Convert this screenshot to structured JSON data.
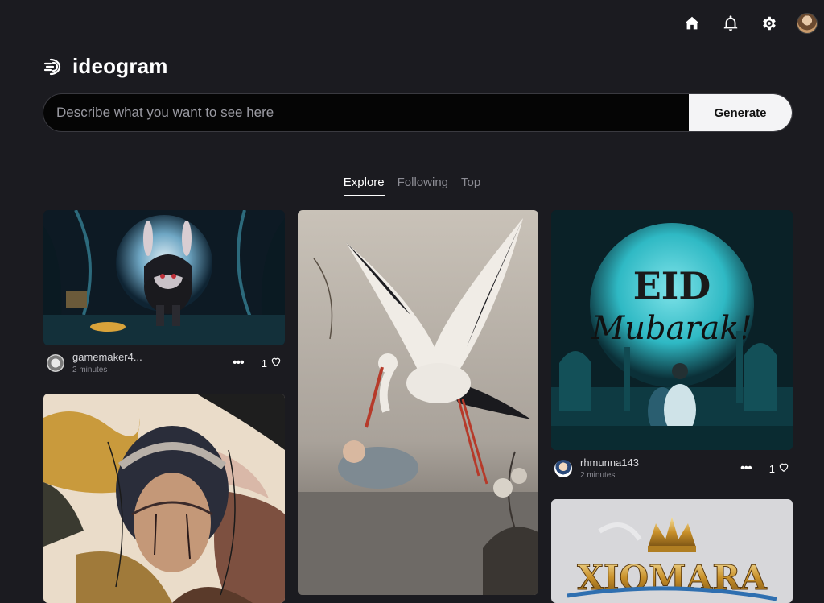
{
  "app": {
    "logo_text": "ideogram"
  },
  "search": {
    "placeholder": "Describe what you want to see here",
    "value": ""
  },
  "generate": {
    "label": "Generate"
  },
  "tabs": [
    {
      "label": "Explore",
      "active": true
    },
    {
      "label": "Following",
      "active": false
    },
    {
      "label": "Top",
      "active": false
    }
  ],
  "cards": [
    {
      "user": "gamemaker4...",
      "time": "2 minutes",
      "likes": "1",
      "image_title": ""
    },
    {
      "user": "rhmunna143",
      "time": "2 minutes",
      "likes": "1",
      "image_title": "EID Mubarak!"
    },
    {
      "user": "",
      "time": "",
      "likes": "",
      "image_title": "XIOMARA"
    }
  ],
  "icons": {
    "home": "home-icon",
    "notifications": "bell-icon",
    "settings": "gear-icon",
    "like": "heart-icon",
    "more": "more-icon"
  },
  "colors": {
    "background": "#1b1b20",
    "search_bg": "#050505",
    "generate_bg": "#f4f4f6",
    "teal": "#2fb9c4"
  }
}
